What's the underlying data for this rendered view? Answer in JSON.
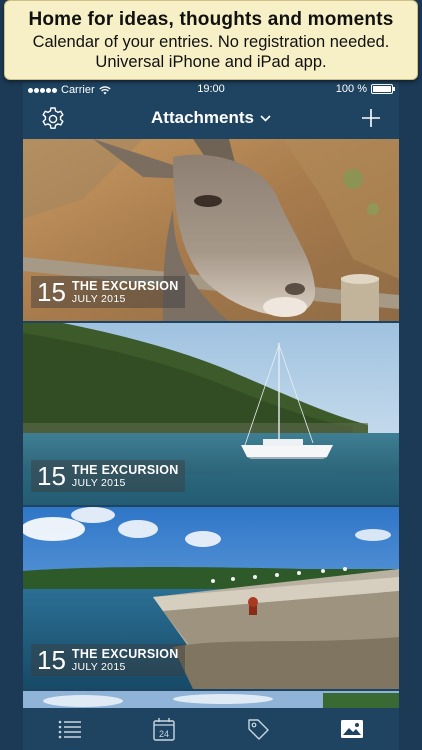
{
  "promo": {
    "line1": "Home for ideas, thoughts and moments",
    "line2": "Calendar of your entries. No registration needed.",
    "line3": "Universal iPhone and iPad app."
  },
  "status_bar": {
    "carrier": "Carrier",
    "time": "19:00",
    "battery": "100 %"
  },
  "nav": {
    "title": "Attachments",
    "left_icon": "gear-icon",
    "right_icon": "plus-icon"
  },
  "entries": [
    {
      "day": "15",
      "title": "THE EXCURSION",
      "date": "JULY 2015",
      "photo": "donkey"
    },
    {
      "day": "15",
      "title": "THE EXCURSION",
      "date": "JULY 2015",
      "photo": "sailboat-bay"
    },
    {
      "day": "15",
      "title": "THE EXCURSION",
      "date": "JULY 2015",
      "photo": "stone-pier"
    }
  ],
  "tabs": [
    {
      "icon": "list-icon"
    },
    {
      "icon": "calendar-icon",
      "label": "24"
    },
    {
      "icon": "tag-icon"
    },
    {
      "icon": "image-icon"
    }
  ],
  "colors": {
    "nav_background": "#1f4461",
    "banner_background": "#f7f0c6",
    "text_light": "#ffffff"
  }
}
